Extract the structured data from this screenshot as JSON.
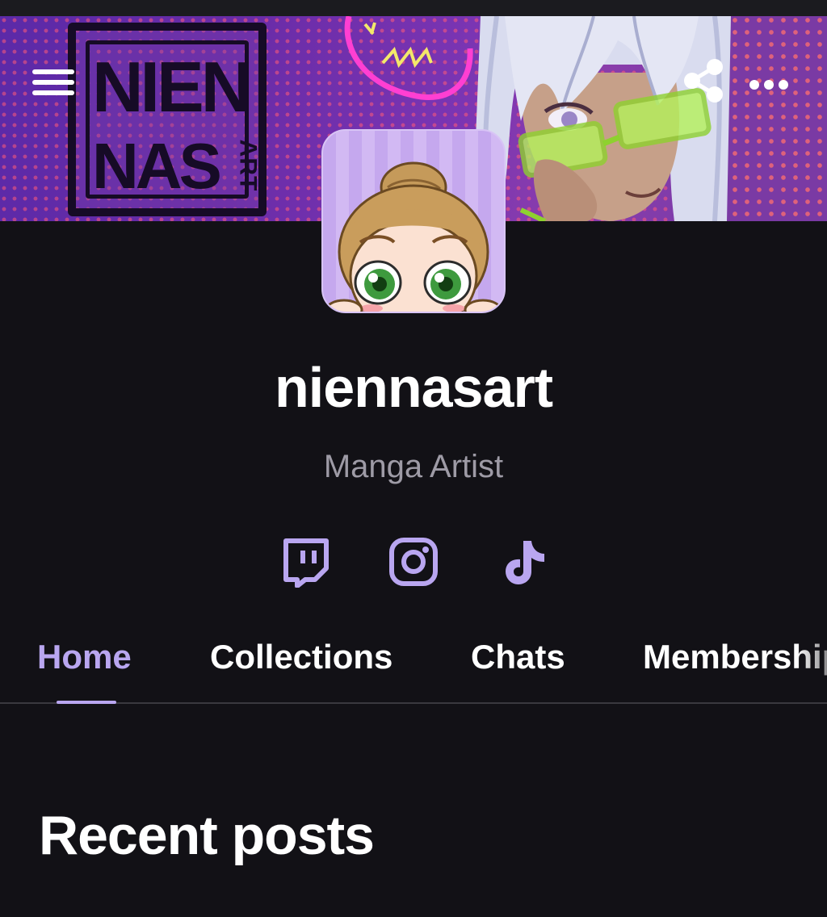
{
  "banner": {
    "logo_line1": "NIEN",
    "logo_line2": "NAS",
    "logo_line3": "ART"
  },
  "header": {
    "menu_icon": "hamburger-menu-icon",
    "share_icon": "share-icon",
    "more_icon": "more-horizontal-icon"
  },
  "profile": {
    "name": "niennasart",
    "tagline": "Manga Artist",
    "socials": [
      {
        "icon": "twitch-icon"
      },
      {
        "icon": "instagram-icon"
      },
      {
        "icon": "tiktok-icon"
      }
    ]
  },
  "tabs": [
    {
      "label": "Home",
      "active": true
    },
    {
      "label": "Collections",
      "active": false
    },
    {
      "label": "Chats",
      "active": false
    },
    {
      "label": "Memberships",
      "active": false
    }
  ],
  "main": {
    "section_heading": "Recent posts"
  },
  "colors": {
    "background": "#121116",
    "accent": "#b9a6f0",
    "text": "#ffffff",
    "muted_text": "#9e9ba6"
  }
}
